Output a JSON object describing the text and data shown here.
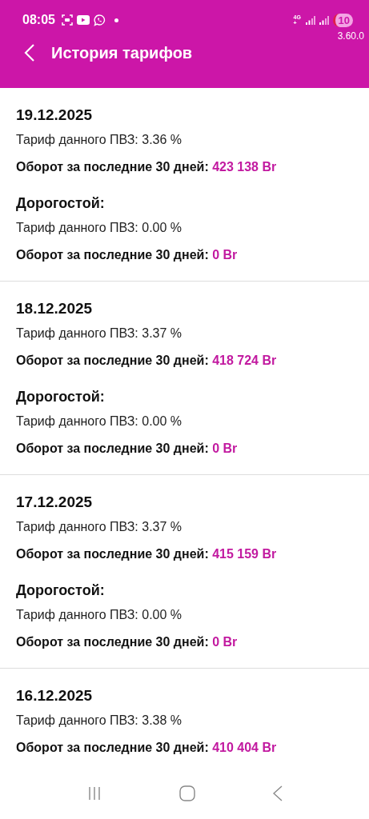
{
  "status_bar": {
    "time": "08:05",
    "network": "4G+",
    "battery": "10",
    "version": "3.60.0"
  },
  "header": {
    "title": "История тарифов"
  },
  "entries": [
    {
      "date": "19.12.2025",
      "groups": [
        {
          "tariff": "Тариф данного ПВЗ: 3.36 %",
          "turnover_label": "Оборот за последние 30 дней:",
          "turnover_value": "423 138 Br"
        },
        {
          "title": "Дорогостой:",
          "tariff": "Тариф данного ПВЗ: 0.00 %",
          "turnover_label": "Оборот за последние 30 дней:",
          "turnover_value": "0 Br"
        }
      ]
    },
    {
      "date": "18.12.2025",
      "groups": [
        {
          "tariff": "Тариф данного ПВЗ: 3.37 %",
          "turnover_label": "Оборот за последние 30 дней:",
          "turnover_value": "418 724 Br"
        },
        {
          "title": "Дорогостой:",
          "tariff": "Тариф данного ПВЗ: 0.00 %",
          "turnover_label": "Оборот за последние 30 дней:",
          "turnover_value": "0 Br"
        }
      ]
    },
    {
      "date": "17.12.2025",
      "groups": [
        {
          "tariff": "Тариф данного ПВЗ: 3.37 %",
          "turnover_label": "Оборот за последние 30 дней:",
          "turnover_value": "415 159 Br"
        },
        {
          "title": "Дорогостой:",
          "tariff": "Тариф данного ПВЗ: 0.00 %",
          "turnover_label": "Оборот за последние 30 дней:",
          "turnover_value": "0 Br"
        }
      ]
    },
    {
      "date": "16.12.2025",
      "groups": [
        {
          "tariff": "Тариф данного ПВЗ: 3.38 %",
          "turnover_label": "Оборот за последние 30 дней:",
          "turnover_value": "410 404 Br"
        }
      ]
    }
  ]
}
